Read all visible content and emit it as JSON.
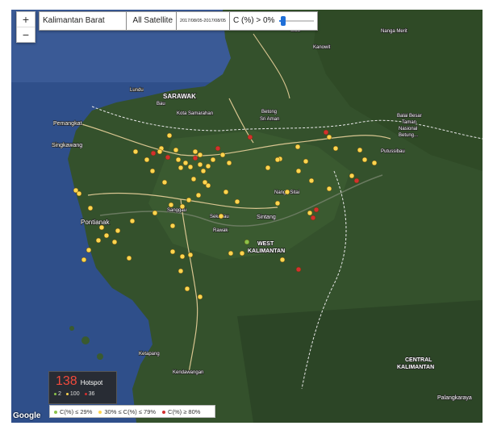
{
  "toolbar": {
    "region": "Kalimantan Barat",
    "satellite": "All Satellite",
    "date_range": "2017/08/05-2017/08/05",
    "confidence_filter": "C (%) > 0%"
  },
  "zoom": {
    "in_label": "+",
    "out_label": "−"
  },
  "hotspot_panel": {
    "count": "138",
    "label": "Hotspot",
    "low_count": "2",
    "mid_count": "100",
    "high_count": "36"
  },
  "legend": {
    "low": "C(%) ≤ 29%",
    "mid": "30% ≤ C(%) ≤ 79%",
    "high": "C(%) ≥ 80%"
  },
  "colors": {
    "low": "#8bc34a",
    "mid": "#ffd54f",
    "high": "#d32f2f",
    "sea": "#2f4f8a",
    "land": "#2f4a2a",
    "roads": "#d8c590",
    "border": "#e8e8e8"
  },
  "attribution": "Google",
  "map_labels": {
    "sarawak": "SARAWAK",
    "west_kalimantan_1": "WEST",
    "west_kalimantan_2": "KALIMANTAN",
    "central_kalimantan_1": "CENTRAL",
    "central_kalimantan_2": "KALIMANTAN",
    "pontianak": "Pontianak",
    "singkawang": "Singkawang",
    "pemangkat": "Pemangkat",
    "sintang": "Sintang",
    "nanga_sitai": "Nanga Sitai",
    "palangkaraya": "Palangkaraya",
    "betong": "Betong",
    "sri_aman": "Sri Aman",
    "sibu": "Sibu",
    "kanowit": "Kanowit",
    "putussibau": "Putussibau",
    "lundu": "Lundu",
    "bau": "Bau",
    "kota_samarahan": "Kota Samarahan",
    "sanggau": "Sanggau",
    "nanga_merit": "Nanga Merit",
    "rawak": "Rawak",
    "sekadau": "Sekadau",
    "kendawangan": "Kendawangan",
    "ketapang": "Ketapang",
    "taman_line1": "Balai Besar",
    "taman_line2": "Taman",
    "taman_line3": "Nasional",
    "taman_line4": "Betung..."
  }
}
